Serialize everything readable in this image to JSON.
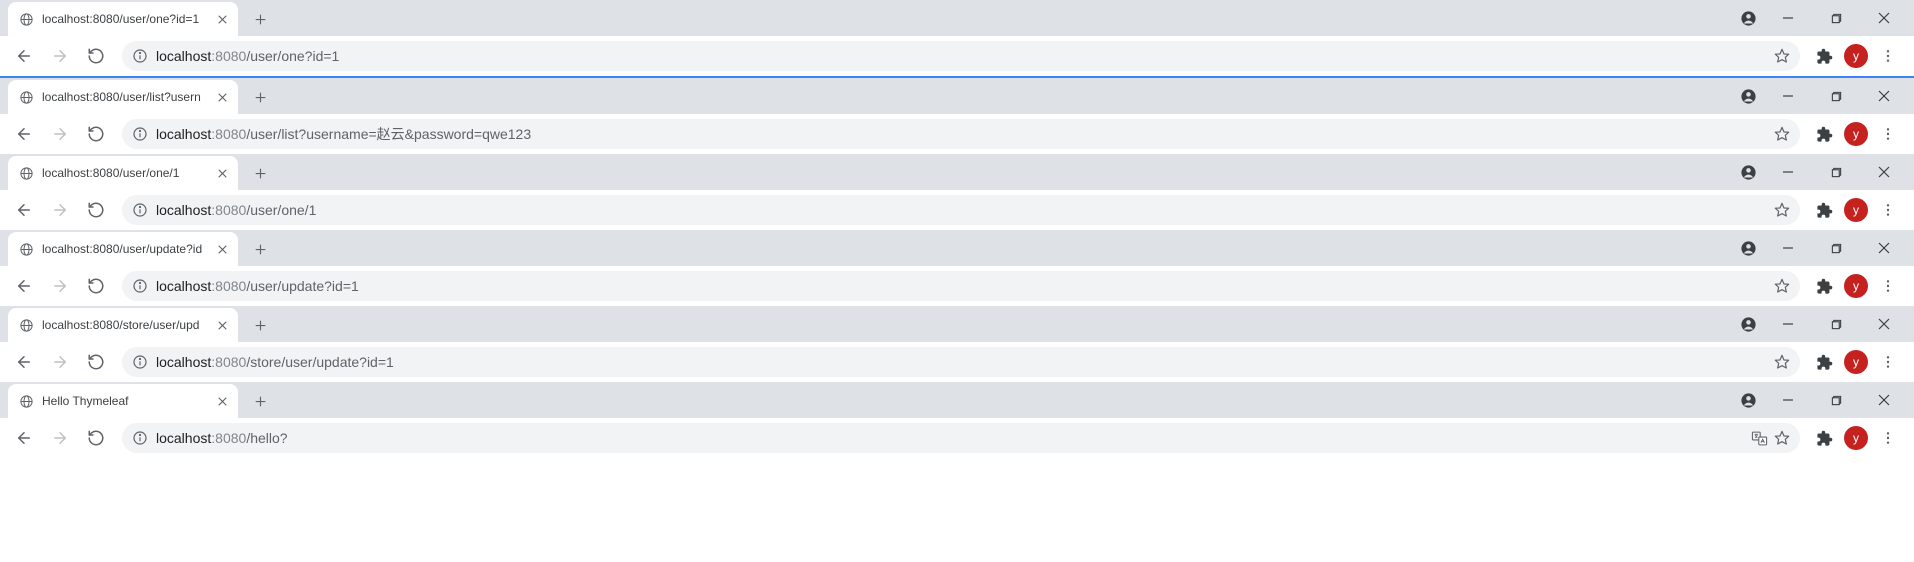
{
  "avatar_letter": "y",
  "windows": [
    {
      "tab_title": "localhost:8080/user/one?id=1",
      "url_host": "localhost",
      "url_port": ":8080",
      "url_path": "/user/one?id=1",
      "highlight": false,
      "show_translate": false
    },
    {
      "tab_title": "localhost:8080/user/list?usern",
      "url_host": "localhost",
      "url_port": ":8080",
      "url_path": "/user/list?username=赵云&password=qwe123",
      "highlight": true,
      "show_translate": false
    },
    {
      "tab_title": "localhost:8080/user/one/1",
      "url_host": "localhost",
      "url_port": ":8080",
      "url_path": "/user/one/1",
      "highlight": false,
      "show_translate": false
    },
    {
      "tab_title": "localhost:8080/user/update?id",
      "url_host": "localhost",
      "url_port": ":8080",
      "url_path": "/user/update?id=1",
      "highlight": false,
      "show_translate": false
    },
    {
      "tab_title": "localhost:8080/store/user/upd",
      "url_host": "localhost",
      "url_port": ":8080",
      "url_path": "/store/user/update?id=1",
      "highlight": false,
      "show_translate": false
    },
    {
      "tab_title": "Hello Thymeleaf",
      "url_host": "localhost",
      "url_port": ":8080",
      "url_path": "/hello?",
      "highlight": false,
      "show_translate": true
    }
  ]
}
